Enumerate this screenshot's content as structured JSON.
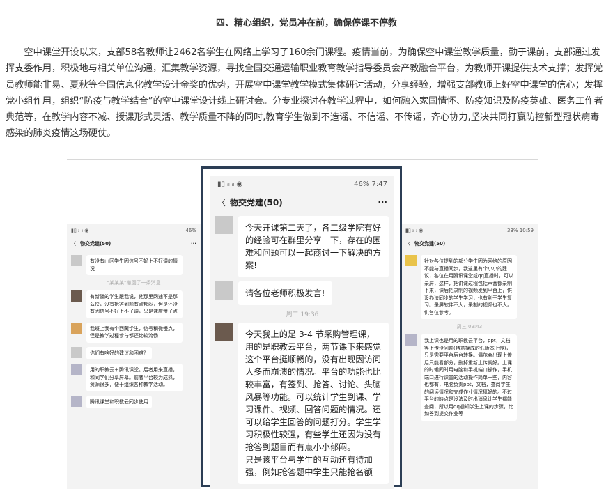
{
  "article": {
    "heading": "四、精心组织，党员冲在前，确保停课不停教",
    "paragraph": "空中课堂开设以来，支部58名教师让2462名学生在网络上学习了160余门课程。疫情当前，为确保空中课堂教学质量，勤于课前，支部通过发挥支委作用，积极地与相关单位沟通，汇集教学资源，寻找全国交通运输职业教育教学指导委员会产教融合平台，为教师开课提供技术支撑；发挥党员教师能非易、夏秋等全国信息化教学设计金奖的优势，开展空中课堂教学模式集体研讨活动，分享经验，增强支部教师上好空中课堂的信心；发挥党小组作用，组织“防疫与教学结合”的空中课堂设计线上研讨会。分专业探讨在教学过程中，如何融入家国情怀、防疫知识及防疫英雄、医务工作者典范等，在教学内容不减、授课形式灵活、教学质量不降的同时,教育学生做到不造谣、不信谣、不传谣，齐心协力,坚决共同打赢防控新型冠状病毒感染的肺炎疫情这场硬仗。"
  },
  "screenshots": {
    "left": {
      "status_right": "46%",
      "chat_title": "物交党建(50)",
      "messages": [
        {
          "text": "有没有山区学生因信号不好上不好课的情况"
        },
        {
          "system": "“某某某”撤回了一条消息"
        },
        {
          "text": "有新疆的学生跟我说，他那里网速不是那么快，没有抢答到题有点郁闷，但是还没有因信号不好上不了课，只是速度慢了点"
        },
        {
          "text": "我班上我有个西藏学生，信号稍微慢点，但是教学过程参与都还比较流畅"
        },
        {
          "text": "你们有啥好的建议和困难？"
        },
        {
          "text": "用的职教云＋腾讯课堂。后者用来直播，和同学们分享屏幕。前者平台较为成熟，资源很多，便于组织各种教学活动。"
        },
        {
          "text": "腾讯课堂和职教云同步使用"
        }
      ]
    },
    "middle": {
      "status_right": "46% 7:47",
      "chat_title": "物交党建(50)",
      "messages": [
        {
          "text": "今天开课第二天了，各二级学院有好的经验可在群里分享一下，存在的困难和问题可以一起商讨一下解决的方案!"
        },
        {
          "text": "请各位老师积极发言!"
        },
        {
          "system": "周二 19:36"
        },
        {
          "text": "今天我上的是 3-4 节采购管理课，用的是职教云平台，两节课下来感觉这个平台挺顺畅的，没有出现因访问人多而崩溃的情况。平台的功能也比较丰富，有签到、抢答、讨论、头脑风暴等功能。可以统计学生到课、学习课件、视频、回答问题的情况。还可以给学生回答的问题打分。学生学习积极性较强，有些学生还因为没有抢答到题目而有点小小郁闷。"
        },
        {
          "text": "只是该平台与学生的互动还有待加强，例如抢答题中学生只能抢名额"
        }
      ]
    },
    "right": {
      "status_right": "33% 10:59",
      "chat_title": "物交党建(50)",
      "messages": [
        {
          "text": "针对各位提到的部分学生因为网络的原因不能与直播同步，我这里有个小小的建议，各位在用腾讯课堂或qq直播时，可以录屏，这样，把讲课过程包括声音都录制下来，课后把录制的视频发到平台上，供没办法同步的学生学习，也有利于学生复习。录屏软件不大，录制的视频也不大。供各位参考。"
        },
        {
          "system": "周三 09:43"
        },
        {
          "text": "我上课也是用的职教云平台，ppt，文档等上传没问题(特意换成的低版本上传)，只是需要平台后台转换。偶尔会出现上传后只能看部分，删掉重新上传就好。上课的时候同时用电脑和手机端口操作，手机端口进行课堂的活动操作简单一些，内容也都有，电脑负责ppt，文档，查阅学生的阅读情况和完成作业情况挺好的。不过平台的缺点是没法及时出消息让学生都能查阅，所以用qq通知学生上课的步骤，比如答到提交作业等"
        }
      ]
    }
  }
}
